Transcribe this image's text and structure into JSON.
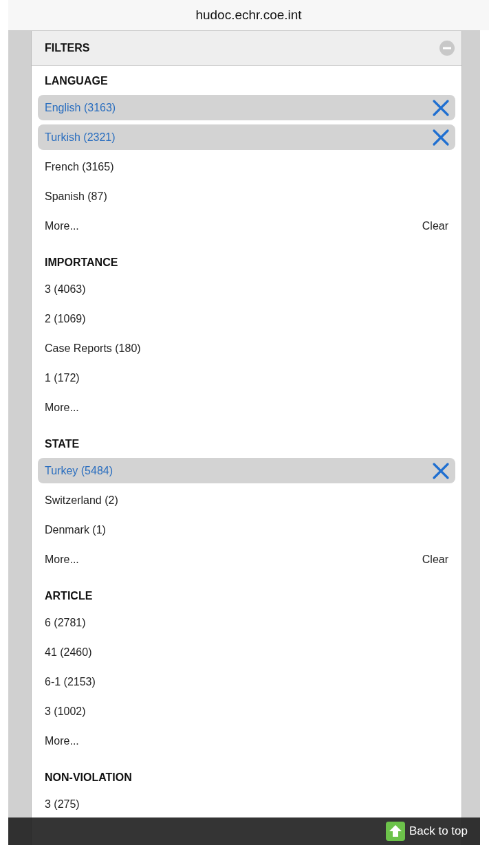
{
  "address_bar": {
    "url": "hudoc.echr.coe.int"
  },
  "panel": {
    "title": "FILTERS"
  },
  "sections": [
    {
      "title": "LANGUAGE",
      "items": [
        {
          "label": "English (3163)",
          "selected": true
        },
        {
          "label": "Turkish (2321)",
          "selected": true
        },
        {
          "label": "French (3165)",
          "selected": false
        },
        {
          "label": "Spanish (87)",
          "selected": false
        }
      ],
      "more": "More...",
      "clear": "Clear"
    },
    {
      "title": "IMPORTANCE",
      "items": [
        {
          "label": "3 (4063)",
          "selected": false
        },
        {
          "label": "2 (1069)",
          "selected": false
        },
        {
          "label": "Case Reports (180)",
          "selected": false
        },
        {
          "label": "1 (172)",
          "selected": false
        }
      ],
      "more": "More..."
    },
    {
      "title": "STATE",
      "items": [
        {
          "label": "Turkey (5484)",
          "selected": true
        },
        {
          "label": "Switzerland (2)",
          "selected": false
        },
        {
          "label": "Denmark (1)",
          "selected": false
        }
      ],
      "more": "More...",
      "clear": "Clear"
    },
    {
      "title": "ARTICLE",
      "items": [
        {
          "label": "6 (2781)",
          "selected": false
        },
        {
          "label": "41 (2460)",
          "selected": false
        },
        {
          "label": "6-1 (2153)",
          "selected": false
        },
        {
          "label": "3 (1002)",
          "selected": false
        }
      ],
      "more": "More..."
    },
    {
      "title": "NON-VIOLATION",
      "items": [
        {
          "label": "3 (275)",
          "selected": false
        }
      ]
    }
  ],
  "footer": {
    "back_to_top": "Back to top"
  }
}
